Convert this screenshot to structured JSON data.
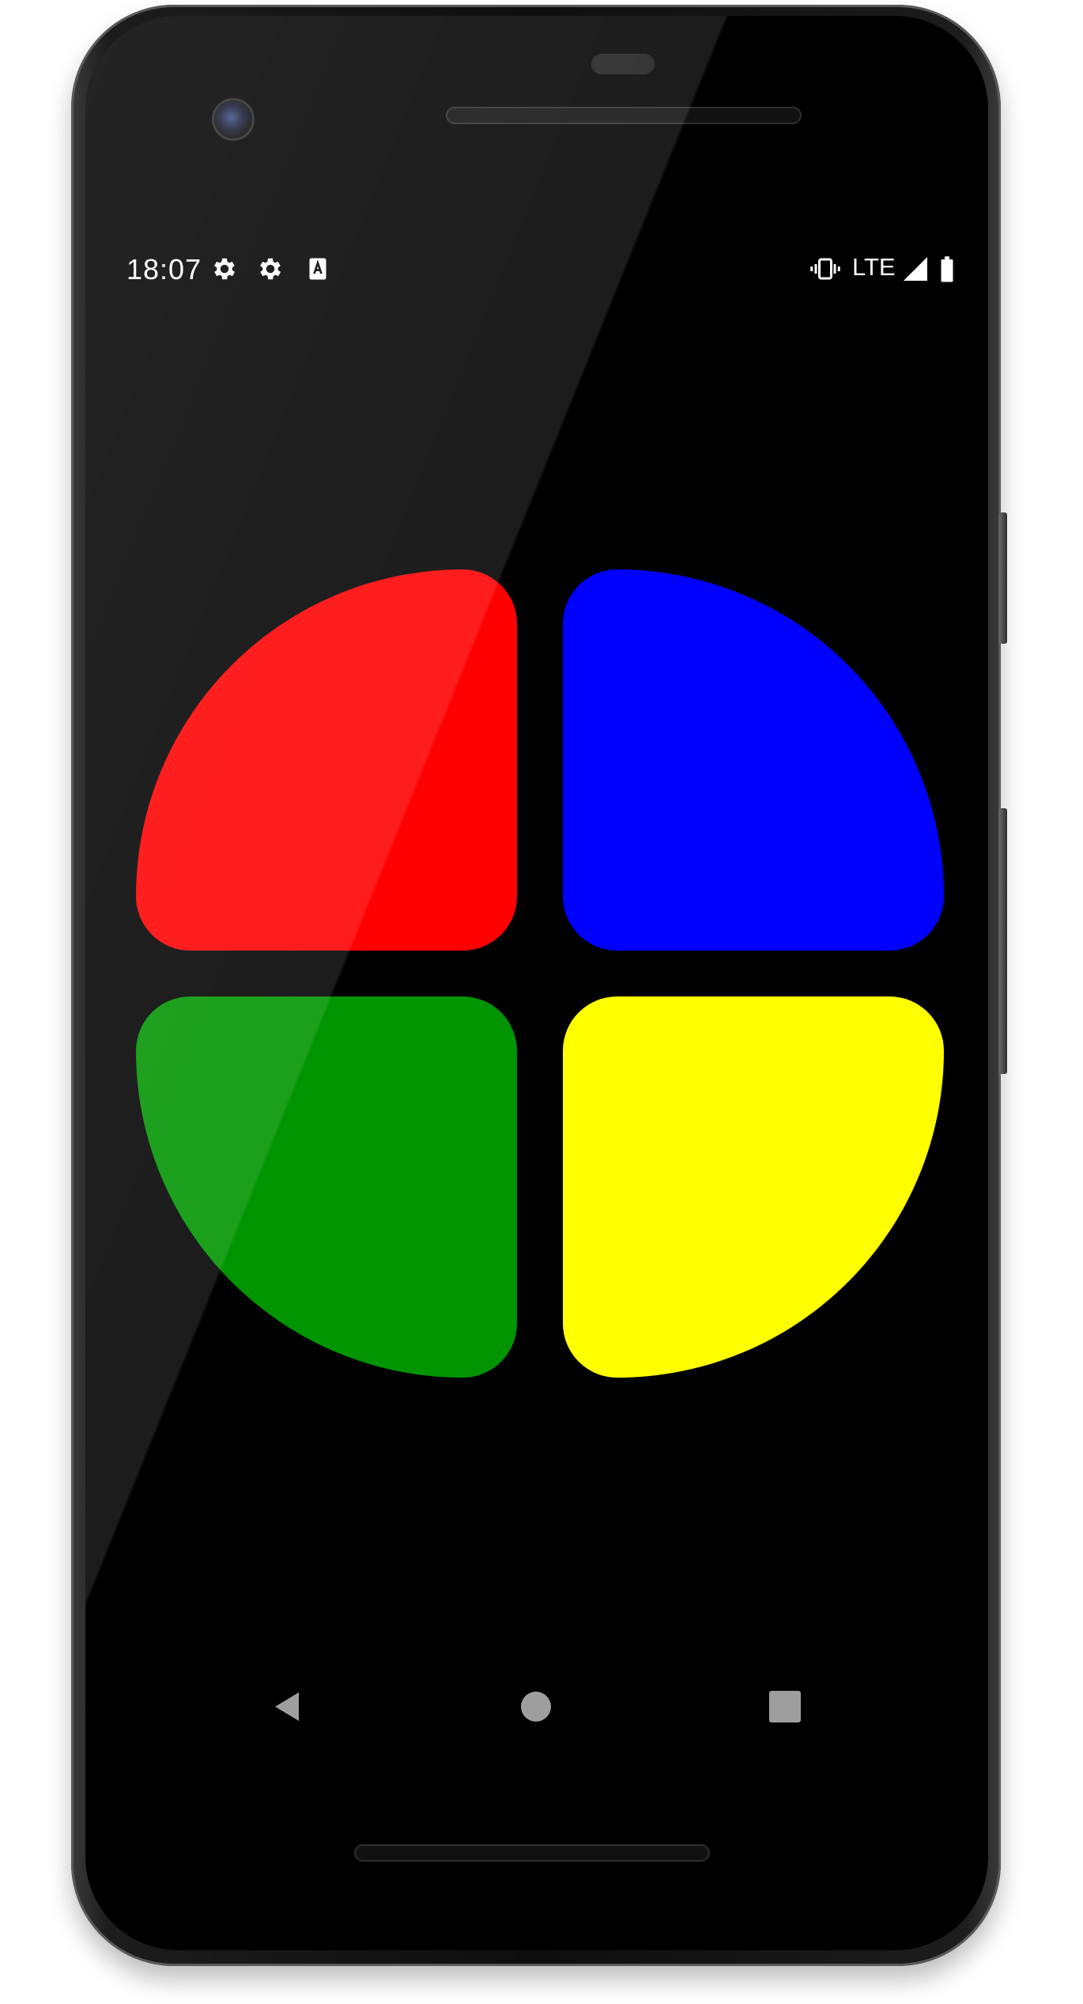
{
  "status_bar": {
    "time": "18:07",
    "network": "LTE",
    "left_icons": [
      "settings-icon",
      "settings-icon",
      "keyboard-indicator-icon"
    ],
    "right_icons": [
      "vibrate-icon",
      "signal-icon",
      "battery-icon"
    ]
  },
  "game": {
    "pads": [
      {
        "name": "red",
        "color": "#ff0000"
      },
      {
        "name": "blue",
        "color": "#0000ff"
      },
      {
        "name": "green",
        "color": "#009400"
      },
      {
        "name": "yellow",
        "color": "#ffff00"
      }
    ]
  },
  "navigation": {
    "buttons": [
      "back-icon",
      "home-icon",
      "recents-icon"
    ],
    "color": "#9e9e9e"
  },
  "colors": {
    "screen_background": "#000000",
    "status_text": "#ffffff"
  }
}
